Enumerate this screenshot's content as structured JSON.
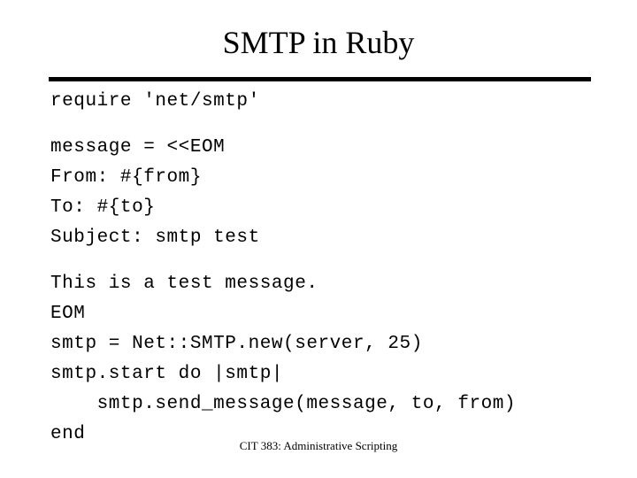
{
  "slide": {
    "title": "SMTP in Ruby",
    "footer": "CIT 383: Administrative Scripting",
    "accent_color": "#000000",
    "background_color": "#ffffff",
    "divider": "horizontal-rule"
  },
  "code": {
    "language": "ruby",
    "lines": [
      {
        "text": "require 'net/smtp'",
        "blank_before": false
      },
      {
        "text": "message = <<EOM",
        "blank_before": true
      },
      {
        "text": "From: #{from}",
        "blank_before": false
      },
      {
        "text": "To: #{to}",
        "blank_before": false
      },
      {
        "text": "Subject: smtp test",
        "blank_before": false
      },
      {
        "text": "This is a test message.",
        "blank_before": true
      },
      {
        "text": "EOM",
        "blank_before": false
      },
      {
        "text": "smtp = Net::SMTP.new(server, 25)",
        "blank_before": false
      },
      {
        "text": "smtp.start do |smtp|",
        "blank_before": false
      },
      {
        "text": "    smtp.send_message(message, to, from)",
        "blank_before": false
      },
      {
        "text": "end",
        "blank_before": false
      }
    ]
  }
}
